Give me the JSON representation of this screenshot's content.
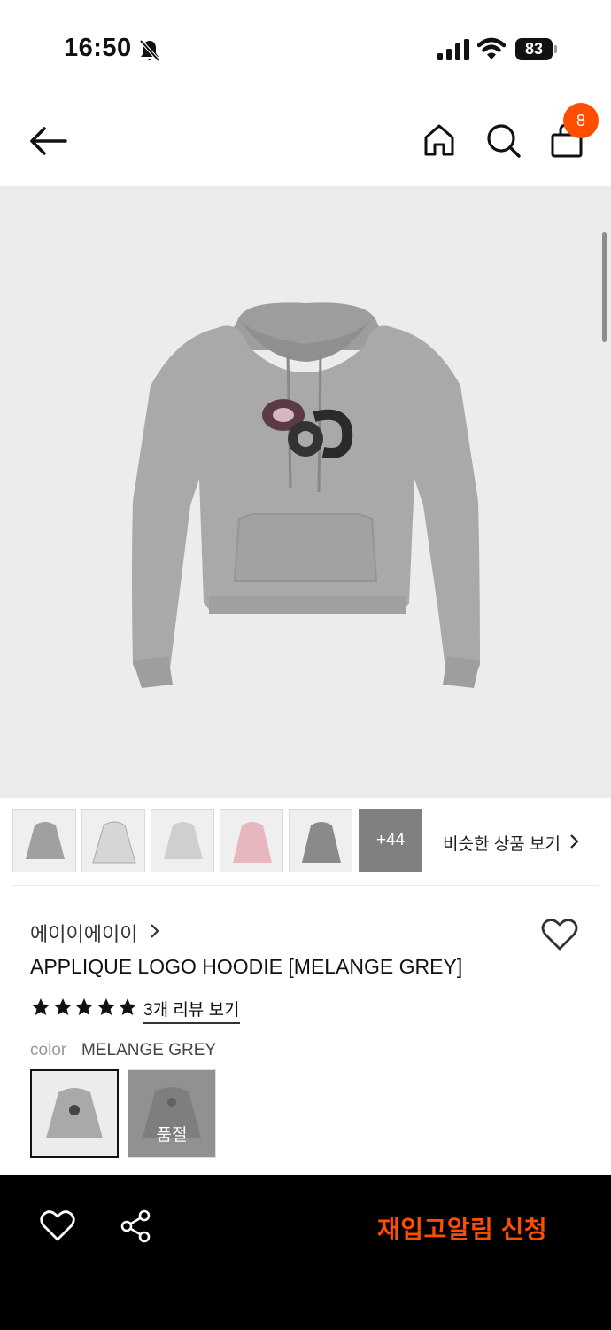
{
  "status_bar": {
    "time": "16:50",
    "battery": "83"
  },
  "header": {
    "cart_count": "8"
  },
  "gallery": {
    "more_label": "+44",
    "similar_label": "비슷한 상품 보기"
  },
  "product": {
    "brand": "에이이에이이",
    "name": "APPLIQUE LOGO HOODIE [MELANGE GREY]",
    "rating_stars": 5,
    "review_link": "3개 리뷰 보기",
    "color_label": "color",
    "color_value": "MELANGE GREY",
    "soldout_label": "품절"
  },
  "bottom_bar": {
    "restock_label": "재입고알림 신청"
  },
  "colors": {
    "accent": "#ff4e00",
    "hoodie_grey": "#a9a9a9",
    "background": "#ececec"
  }
}
